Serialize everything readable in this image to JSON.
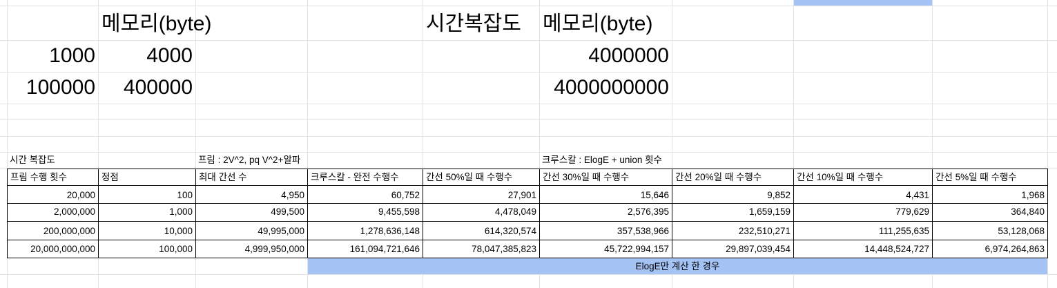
{
  "top": {
    "header_memory_left": "메모리(byte)",
    "header_time_complexity": "시간복잡도",
    "header_memory_right": "메모리(byte)",
    "rows": [
      {
        "n": "1000",
        "mem": "4000",
        "mem2": "4000000"
      },
      {
        "n": "100000",
        "mem": "400000",
        "mem2": "4000000000"
      }
    ]
  },
  "section_labels": {
    "time_complexity": "시간 복잡도",
    "prim": "프림 : 2V^2, pq V^2+알파",
    "kruskal": "크루스칼 : ElogE + union 횟수"
  },
  "table": {
    "headers": [
      "프림 수행 횟수",
      "정점",
      "최대 간선 수",
      "크루스칼 - 완전 수행수",
      "간선 50%일 때 수행수",
      "간선 30%일 때 수행수",
      "간선 20%일 때 수행수",
      "간선 10%일 때 수행수",
      "간선 5%일 때 수행수"
    ],
    "rows": [
      [
        "20,000",
        "100",
        "4,950",
        "60,752",
        "27,901",
        "15,646",
        "9,852",
        "4,431",
        "1,968"
      ],
      [
        "2,000,000",
        "1,000",
        "499,500",
        "9,455,598",
        "4,478,049",
        "2,576,395",
        "1,659,159",
        "779,629",
        "364,840"
      ],
      [
        "200,000,000",
        "10,000",
        "49,995,000",
        "1,278,636,148",
        "614,320,574",
        "357,538,966",
        "232,510,271",
        "111,255,635",
        "53,128,068"
      ],
      [
        "20,000,000,000",
        "100,000",
        "4,999,950,000",
        "161,094,721,646",
        "78,047,385,823",
        "45,722,994,157",
        "29,897,039,454",
        "14,448,524,727",
        "6,974,264,863"
      ]
    ],
    "note": "ElogE만 계산 한 경우"
  },
  "colors": {
    "highlight": "#a4c2f4",
    "gridline": "#e2e3e3",
    "border": "#000000"
  }
}
